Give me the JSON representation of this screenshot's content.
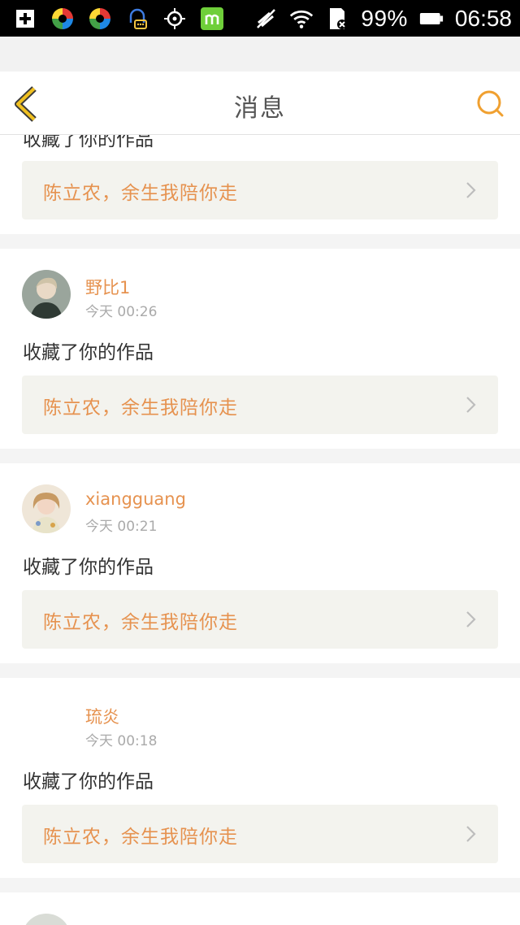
{
  "status_bar": {
    "battery_percent": "99%",
    "time": "06:58",
    "left_icons": [
      "plus-box-icon",
      "color-wheel-app-icon",
      "color-wheel-app-icon",
      "chat-bell-icon",
      "crosshair-icon",
      "m-app-icon"
    ],
    "right_icons": [
      "mute-icon",
      "wifi-icon",
      "sd-card-icon",
      "battery-icon"
    ]
  },
  "header": {
    "title": "消息",
    "back_icon": "chevron-left-icon",
    "search_icon": "search-icon",
    "accent_color": "#f0a030"
  },
  "feed": {
    "items": [
      {
        "username": "",
        "timestamp": "",
        "action": "收藏了你的作品",
        "work_title": "陈立农，余生我陪你走"
      },
      {
        "username": "野比1",
        "timestamp": "今天 00:26",
        "action": "收藏了你的作品",
        "work_title": "陈立农，余生我陪你走"
      },
      {
        "username": "xiangguang",
        "timestamp": "今天 00:21",
        "action": "收藏了你的作品",
        "work_title": "陈立农，余生我陪你走"
      },
      {
        "username": "琉炎",
        "timestamp": "今天 00:18",
        "action": "收藏了你的作品",
        "work_title": "陈立农，余生我陪你走"
      }
    ]
  },
  "colors": {
    "username": "#e6924f",
    "link_text": "#e6924f",
    "link_bg": "#f3f3ee",
    "action_text": "#333333",
    "timestamp": "#aaaaaa",
    "divider": "#f4f4f4"
  }
}
